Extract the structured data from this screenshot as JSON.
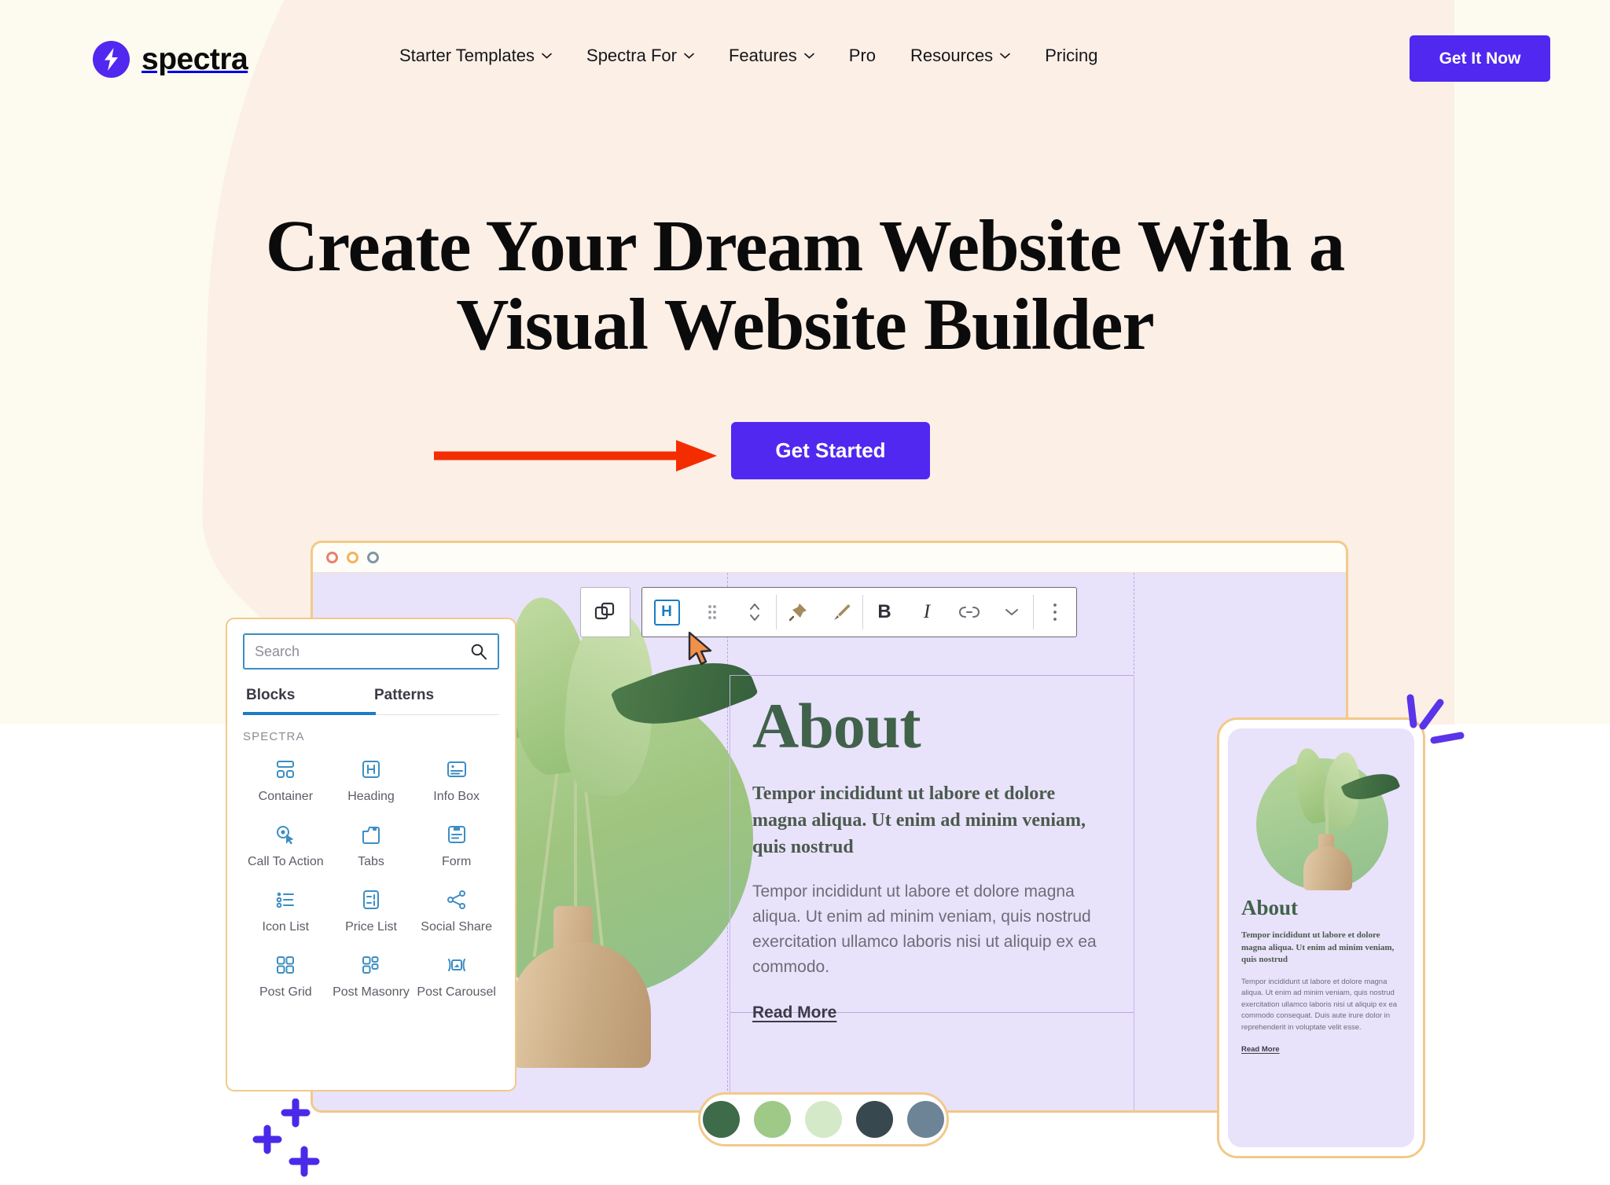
{
  "colors": {
    "brand_purple": "#5028f0",
    "bg_cream": "#fdfbef",
    "bg_peach": "#fbefe6",
    "annotation_red": "#f42d00",
    "editor_frame": "#f2c98a",
    "canvas_lavender": "#e9e2fb",
    "heading_green": "#40624a",
    "tab_blue": "#1a7dc4"
  },
  "header": {
    "logo_text": "spectra",
    "nav": [
      {
        "label": "Starter Templates",
        "has_dropdown": true
      },
      {
        "label": "Spectra For",
        "has_dropdown": true
      },
      {
        "label": "Features",
        "has_dropdown": true
      },
      {
        "label": "Pro",
        "has_dropdown": false
      },
      {
        "label": "Resources",
        "has_dropdown": true
      },
      {
        "label": "Pricing",
        "has_dropdown": false
      }
    ],
    "cta_label": "Get It Now"
  },
  "hero": {
    "title_line1": "Create Your Dream Website With a",
    "title_line2": "Visual Website Builder",
    "cta_label": "Get Started",
    "annotation": "red-arrow-pointing-right"
  },
  "inserter": {
    "search_placeholder": "Search",
    "search_value": "",
    "tabs": [
      {
        "label": "Blocks",
        "active": true
      },
      {
        "label": "Patterns",
        "active": false
      }
    ],
    "section_label": "SPECTRA",
    "blocks": [
      {
        "label": "Container",
        "icon": "container-icon"
      },
      {
        "label": "Heading",
        "icon": "heading-icon"
      },
      {
        "label": "Info Box",
        "icon": "info-box-icon"
      },
      {
        "label": "Call To Action",
        "icon": "call-to-action-icon"
      },
      {
        "label": "Tabs",
        "icon": "tabs-icon"
      },
      {
        "label": "Form",
        "icon": "form-icon"
      },
      {
        "label": "Icon List",
        "icon": "icon-list-icon"
      },
      {
        "label": "Price List",
        "icon": "price-list-icon"
      },
      {
        "label": "Social Share",
        "icon": "social-share-icon"
      },
      {
        "label": "Post Grid",
        "icon": "post-grid-icon"
      },
      {
        "label": "Post Masonry",
        "icon": "post-masonry-icon"
      },
      {
        "label": "Post Carousel",
        "icon": "post-carousel-icon"
      }
    ]
  },
  "editor": {
    "window_dots": [
      "red",
      "yellow",
      "gray"
    ],
    "toolbar": {
      "copy_icon": "duplicate-icon",
      "items": [
        {
          "name": "heading-block-type",
          "label": "H",
          "active": true
        },
        {
          "name": "drag-handle",
          "label": ""
        },
        {
          "name": "move-up-down",
          "label": ""
        },
        {
          "name": "pin-tool",
          "label": ""
        },
        {
          "name": "brush-tool",
          "label": ""
        },
        {
          "name": "bold",
          "label": "B"
        },
        {
          "name": "italic",
          "label": "I"
        },
        {
          "name": "link",
          "label": ""
        },
        {
          "name": "more-formatting",
          "label": ""
        },
        {
          "name": "options-menu",
          "label": ""
        }
      ]
    },
    "content": {
      "heading": "About",
      "subheading": "Tempor incididunt ut labore et dolore magna aliqua. Ut enim ad minim veniam, quis nostrud",
      "body": "Tempor incididunt ut labore et dolore magna aliqua. Ut enim ad minim veniam, quis nostrud exercitation ullamco laboris nisi ut aliquip ex ea commodo.",
      "read_more": "Read More"
    }
  },
  "phone": {
    "heading": "About",
    "subheading": "Tempor incididunt ut labore et dolore magna aliqua. Ut enim ad minim veniam, quis nostrud",
    "body": "Tempor incididunt ut labore et dolore magna aliqua. Ut enim ad minim veniam, quis nostrud exercitation ullamco laboris nisi ut aliquip ex ea commodo consequat. Duis aute irure dolor in reprehenderit in voluptate velit esse.",
    "read_more": "Read More"
  },
  "palette": {
    "swatches": [
      "#3e6b4a",
      "#9fc987",
      "#d4e9c8",
      "#38484f",
      "#6d8396"
    ]
  }
}
